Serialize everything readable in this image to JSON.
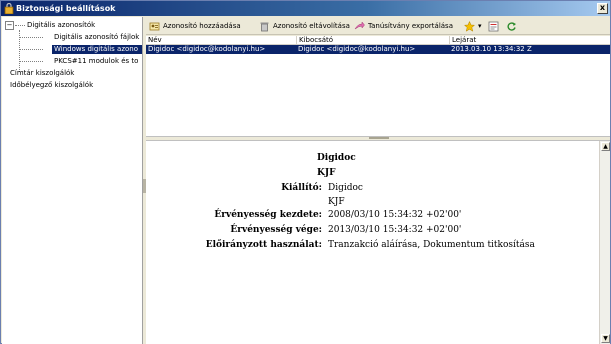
{
  "window": {
    "title": "Biztonsági beállítások",
    "close_label": "x"
  },
  "tree": {
    "root": "Digitális azonosítók",
    "children": [
      "Digitális azonosító fájlok",
      "Windows digitális azono",
      "PKCS#11 modulok és to"
    ],
    "others": [
      "Címtár kiszolgálók",
      "Időbélyegző kiszolgálók"
    ]
  },
  "toolbar": {
    "add_label": "Azonosító hozzáadása",
    "remove_label": "Azonosító eltávolítása",
    "export_label": "Tanúsítvány exportálása",
    "star_dropdown": "▾"
  },
  "table": {
    "columns": [
      "Név",
      "Kibocsátó",
      "Lejárat"
    ],
    "rows": [
      [
        "Digidoc <digidoc@kodolanyi.hu>",
        "Digidoc <digidoc@kodolanyi.hu>",
        "2013.03.10 13:34:32 Z"
      ]
    ]
  },
  "details": {
    "name": "Digidoc",
    "org": "KJF",
    "issuer_label": "Kiállító:",
    "issuer_name": "Digidoc",
    "issuer_org": "KJF",
    "valid_from_label": "Érvényesség kezdete:",
    "valid_from": "2008/03/10 15:34:32 +02'00'",
    "valid_to_label": "Érvényesség vége:",
    "valid_to": "2013/03/10 15:34:32 +02'00'",
    "usage_label": "Előirányzott használat:",
    "usage": "Tranzakció aláírása, Dokumentum titkosítása"
  },
  "colors": {
    "selection": "#0a246a",
    "titlebar": "#0a246a"
  }
}
